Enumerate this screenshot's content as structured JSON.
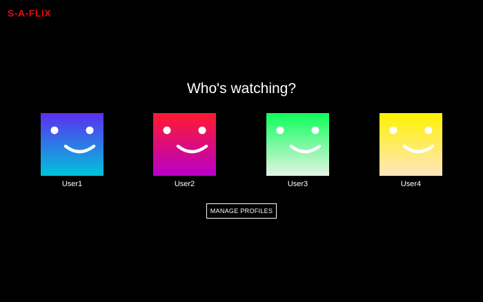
{
  "app": {
    "logo": "S-A-FLIX"
  },
  "main": {
    "heading": "Who's watching?",
    "profiles": [
      {
        "name": "User1",
        "gradient": [
          "#5b2ff0",
          "#00c4d9"
        ],
        "icon": "smiley-face-icon"
      },
      {
        "name": "User2",
        "gradient": [
          "#ff1a2e",
          "#b800c8"
        ],
        "icon": "smiley-face-icon"
      },
      {
        "name": "User3",
        "gradient": [
          "#0dff5a",
          "#e6f3e6"
        ],
        "icon": "smiley-face-icon"
      },
      {
        "name": "User4",
        "gradient": [
          "#fff200",
          "#ffe6c0"
        ],
        "icon": "smiley-face-icon"
      }
    ],
    "manage_label": "MANAGE PROFILES"
  },
  "colors": {
    "background": "#000000",
    "brand": "#e50914",
    "text": "#ffffff"
  }
}
